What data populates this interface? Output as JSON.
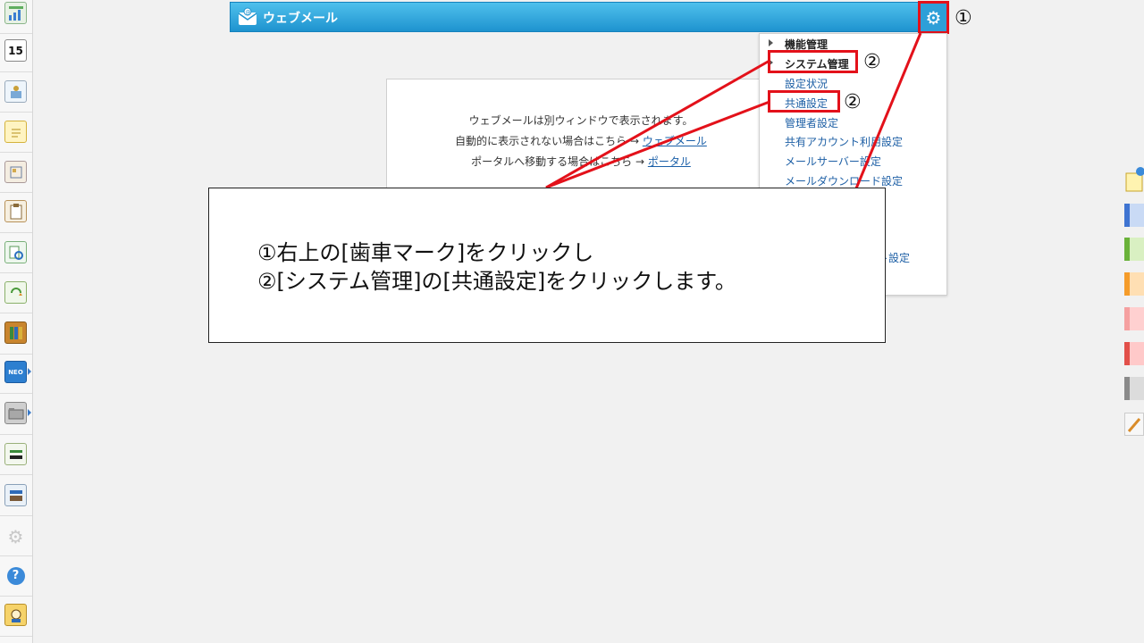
{
  "header": {
    "title": "ウェブメール",
    "brand_color": "#1e93cf",
    "icons": [
      "mail-icon",
      "gear-icon"
    ]
  },
  "message": {
    "line1": "ウェブメールは別ウィンドウで表示されます。",
    "line2_prefix": "自動的に表示されない場合はこちら → ",
    "line2_link": "ウェブメール",
    "line3_prefix": "ポータルへ移動する場合はこちら → ",
    "line3_link": "ポータル"
  },
  "menu": {
    "section1": "機能管理",
    "section2": "システム管理",
    "items": [
      "設定状況",
      "共通設定",
      "管理者設定",
      "共有アカウント利用設定",
      "メールサーバー設定",
      "メールダウンロード設定"
    ],
    "partial_item": "スト設定"
  },
  "callouts": {
    "one": "①",
    "two_a": "②",
    "two_b": "②"
  },
  "note": {
    "line1": "①右上の[歯車マーク]をクリックし",
    "line2": "②[システム管理]の[共通設定]をクリックします。"
  },
  "colors": {
    "annotation_red": "#e3111a",
    "link_blue": "#1d5fa5"
  }
}
